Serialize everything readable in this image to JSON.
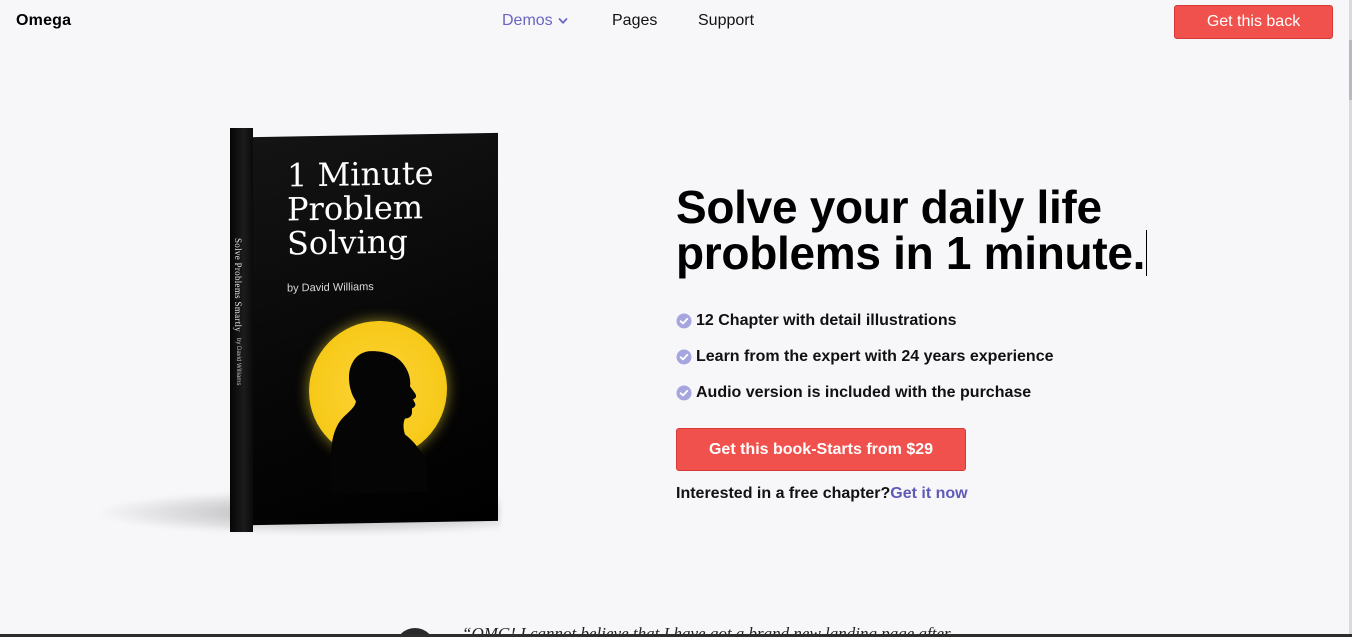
{
  "navbar": {
    "brand": "Omega",
    "links": [
      {
        "label": "Demos",
        "active": true,
        "has_dropdown": true
      },
      {
        "label": "Pages",
        "active": false
      },
      {
        "label": "Support",
        "active": false
      }
    ],
    "cta_label": "Get this back"
  },
  "book": {
    "title_lines": [
      "1 Minute",
      "Problem",
      "Solving"
    ],
    "author": "by David Williams",
    "spine_title": "Solve Problems Smartly",
    "spine_author": "by David Williams"
  },
  "hero": {
    "headline_line1": "Solve your daily life",
    "headline_line2": "problems in 1 minute.",
    "features": [
      "12 Chapter with detail illustrations",
      "Learn from the expert with 24 years experience",
      "Audio version is included with the purchase"
    ],
    "cta_label": "Get this book-Starts from $29",
    "free_chapter_text": "Interested in a free chapter?",
    "free_chapter_link": "Get it now"
  },
  "testimonial": {
    "quote_partial": "“OMG! I cannot believe that I have got a brand new landing page after"
  },
  "colors": {
    "accent_red": "#f1514d",
    "link_purple": "#5f5ab8",
    "nav_active": "#6a65c2",
    "check_circle": "#a7a5e0",
    "background": "#f7f7fa"
  },
  "icons": {
    "dropdown": "chevron-down-icon",
    "feature": "check-circle-icon"
  }
}
